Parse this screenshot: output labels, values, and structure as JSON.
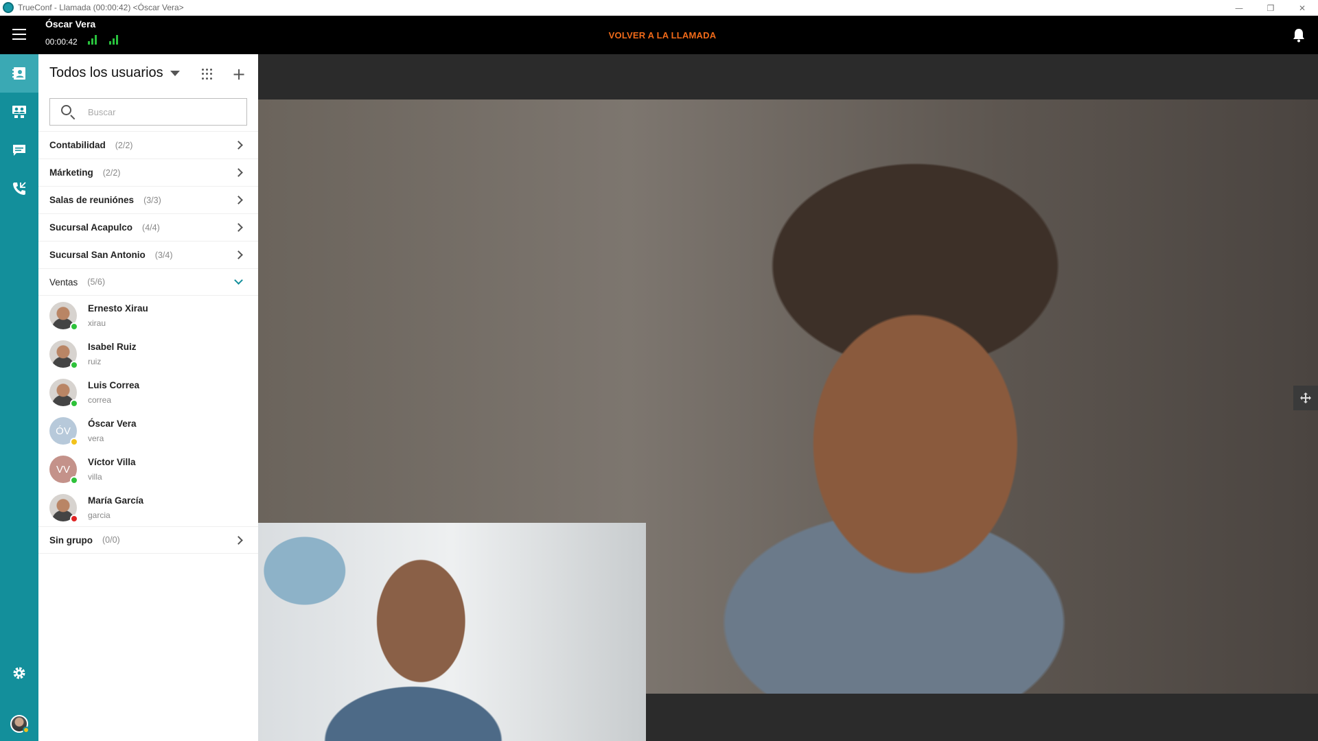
{
  "window": {
    "title": "TrueConf - Llamada (00:00:42) <Óscar Vera>",
    "minimize": "—",
    "restore": "❐",
    "close": "✕"
  },
  "call": {
    "caller": "Óscar Vera",
    "timer": "00:00:42",
    "return_label": "VOLVER A LA LLAMADA",
    "signal_color": "#29c23d",
    "accent_color": "#f06a19"
  },
  "rail": {
    "color": "#138f9b",
    "items": [
      "contacts-icon",
      "conferences-icon",
      "chat-icon",
      "call-history-icon",
      "settings-icon"
    ]
  },
  "contacts": {
    "header": "Todos los usuarios",
    "search_placeholder": "Buscar",
    "groups_top": [
      {
        "name": "Contabilidad",
        "count": "(2/2)"
      },
      {
        "name": "Márketing",
        "count": "(2/2)"
      },
      {
        "name": "Salas de reuniónes",
        "count": "(3/3)"
      },
      {
        "name": "Sucursal Acapulco",
        "count": "(4/4)"
      },
      {
        "name": "Sucursal San Antonio",
        "count": "(3/4)"
      }
    ],
    "expanded_group": {
      "name": "Ventas",
      "count": "(5/6)"
    },
    "users": [
      {
        "name": "Ernesto Xirau",
        "login": "xirau",
        "status": "green",
        "initials": ""
      },
      {
        "name": "Isabel Ruiz",
        "login": "ruiz",
        "status": "green",
        "initials": ""
      },
      {
        "name": "Luis Correa",
        "login": "correa",
        "status": "green",
        "initials": ""
      },
      {
        "name": "Óscar Vera",
        "login": "vera",
        "status": "yellow",
        "initials": "ÓV"
      },
      {
        "name": "Víctor Villa",
        "login": "villa",
        "status": "green",
        "initials": "VV"
      },
      {
        "name": "María García",
        "login": "garcia",
        "status": "red",
        "initials": ""
      }
    ],
    "groups_bottom": [
      {
        "name": "Sin grupo",
        "count": "(0/0)"
      }
    ]
  }
}
